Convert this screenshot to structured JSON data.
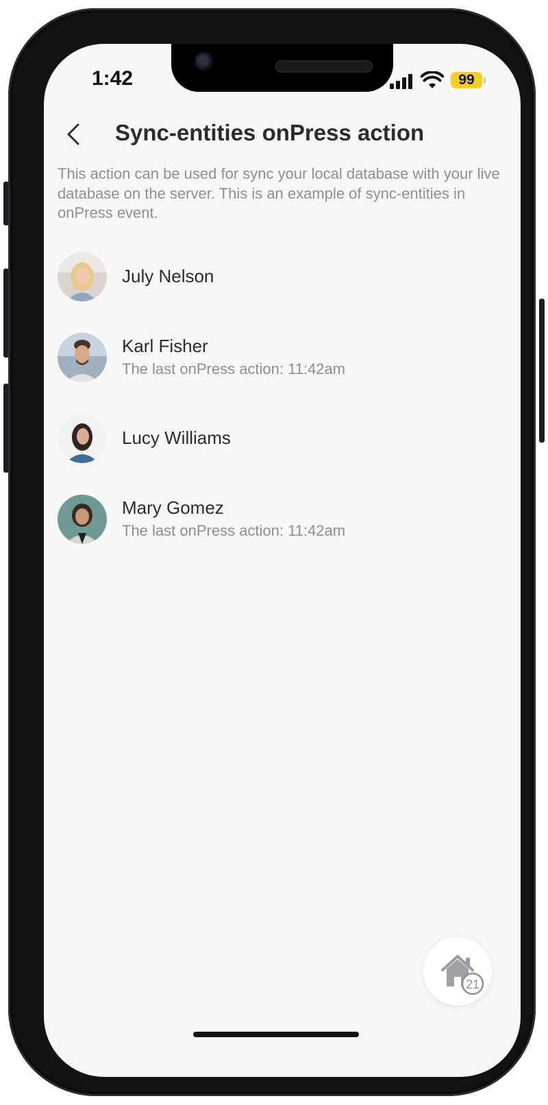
{
  "status_bar": {
    "time": "1:42",
    "battery": "99",
    "signal_icon": "cellular-signal-icon",
    "wifi_icon": "wifi-icon"
  },
  "header": {
    "back_icon": "chevron-left-icon",
    "title": "Sync-entities onPress action"
  },
  "description": "This action can be used for sync your local database with your live database on the server. This is an example of sync-entities in onPress event.",
  "users": [
    {
      "name": "July Nelson",
      "subtitle": ""
    },
    {
      "name": "Karl Fisher",
      "subtitle": "The last onPress action: 11:42am"
    },
    {
      "name": "Lucy Williams",
      "subtitle": ""
    },
    {
      "name": "Mary Gomez",
      "subtitle": "The last onPress action: 11:42am"
    }
  ],
  "fab": {
    "icon": "home-icon",
    "badge": "21"
  },
  "colors": {
    "screen_bg": "#f7f7f7",
    "battery": "#f6cf21",
    "title": "#2c2c2e",
    "secondary_text": "#8e8e93"
  }
}
